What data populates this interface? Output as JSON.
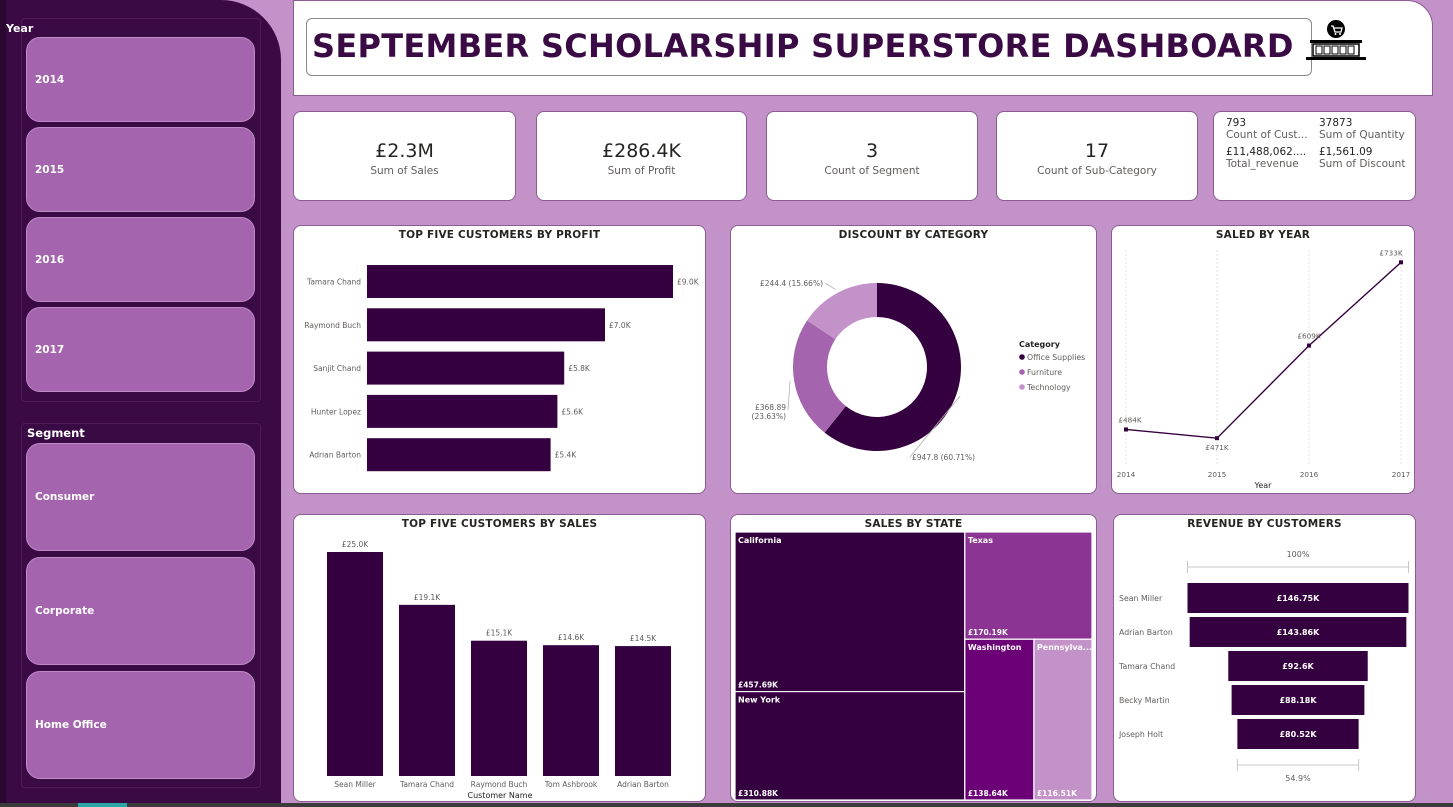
{
  "title": "SEPTEMBER SCHOLARSHIP SUPERSTORE DASHBOARD",
  "slicers": {
    "year": {
      "title": "Year",
      "options": [
        "2014",
        "2015",
        "2016",
        "2017"
      ]
    },
    "segment": {
      "title": "Segment",
      "options": [
        "Consumer",
        "Corporate",
        "Home Office"
      ]
    }
  },
  "kpis": [
    {
      "value": "£2.3M",
      "label": "Sum of Sales"
    },
    {
      "value": "£286.4K",
      "label": "Sum of Profit"
    },
    {
      "value": "3",
      "label": "Count of Segment"
    },
    {
      "value": "17",
      "label": "Count of Sub-Category"
    }
  ],
  "multi_kpi": [
    {
      "value": "793",
      "label": "Count of Cust..."
    },
    {
      "value": "37873",
      "label": "Sum of Quantity"
    },
    {
      "value": "£11,488,062....",
      "label": "Total_revenue"
    },
    {
      "value": "£1,561.09",
      "label": "Sum of Discount"
    }
  ],
  "colors": {
    "dark": "#35003f",
    "mid": "#a564ae",
    "light": "#c392c8",
    "texas": "#8b3494",
    "washington": "#6b0077",
    "pennsylvania": "#c392c8"
  },
  "chart_data": [
    {
      "type": "bar",
      "orientation": "horizontal",
      "title": "TOP FIVE CUSTOMERS BY PROFIT",
      "categories": [
        "Tamara Chand",
        "Raymond Buch",
        "Sanjit Chand",
        "Hunter Lopez",
        "Adrian Barton"
      ],
      "values": [
        9.0,
        7.0,
        5.8,
        5.6,
        5.4
      ],
      "data_labels": [
        "£9.0K",
        "£7.0K",
        "£5.8K",
        "£5.6K",
        "£5.4K"
      ],
      "xlim": [
        0,
        9.0
      ]
    },
    {
      "type": "pie",
      "variant": "donut",
      "title": "DISCOUNT BY CATEGORY",
      "legend_title": "Category",
      "legend_position": "right",
      "categories": [
        "Office Supplies",
        "Furniture",
        "Technology"
      ],
      "values": [
        947.8,
        368.89,
        244.4
      ],
      "data_labels": [
        "£947.8 (60.71%)",
        "£368.89 (23.63%)",
        "£244.4 (15.66%)"
      ]
    },
    {
      "type": "line",
      "title": "SALED BY YEAR",
      "xlabel": "Year",
      "x": [
        "2014",
        "2015",
        "2016",
        "2017"
      ],
      "values": [
        484,
        471,
        609,
        733
      ],
      "data_labels": [
        "£484K",
        "£471K",
        "£609K",
        "£733K"
      ],
      "ylim": [
        440,
        735
      ]
    },
    {
      "type": "bar",
      "orientation": "vertical",
      "title": "TOP FIVE CUSTOMERS BY SALES",
      "xlabel": "Customer Name",
      "categories": [
        "Sean Miller",
        "Tamara Chand",
        "Raymond Buch",
        "Tom Ashbrook",
        "Adrian Barton"
      ],
      "values": [
        25.0,
        19.1,
        15.1,
        14.6,
        14.5
      ],
      "data_labels": [
        "£25.0K",
        "£19.1K",
        "£15.1K",
        "£14.6K",
        "£14.5K"
      ],
      "ylim": [
        0,
        25.0
      ]
    },
    {
      "type": "treemap",
      "title": "SALES BY STATE",
      "categories": [
        "California",
        "New York",
        "Texas",
        "Washington",
        "Pennsylva..."
      ],
      "values": [
        457.69,
        310.88,
        170.19,
        138.64,
        116.51
      ],
      "data_labels": [
        "£457.69K",
        "£310.88K",
        "£170.19K",
        "£138.64K",
        "£116.51K"
      ]
    },
    {
      "type": "funnel",
      "title": "REVENUE BY CUSTOMERS",
      "categories": [
        "Sean Miller",
        "Adrian Barton",
        "Tamara Chand",
        "Becky Martin",
        "Joseph Holt"
      ],
      "values": [
        146.75,
        143.86,
        92.6,
        88.18,
        80.52
      ],
      "data_labels": [
        "£146.75K",
        "£143.86K",
        "£92.6K",
        "£88.18K",
        "£80.52K"
      ],
      "top_label": "100%",
      "bottom_label": "54.9%"
    }
  ]
}
